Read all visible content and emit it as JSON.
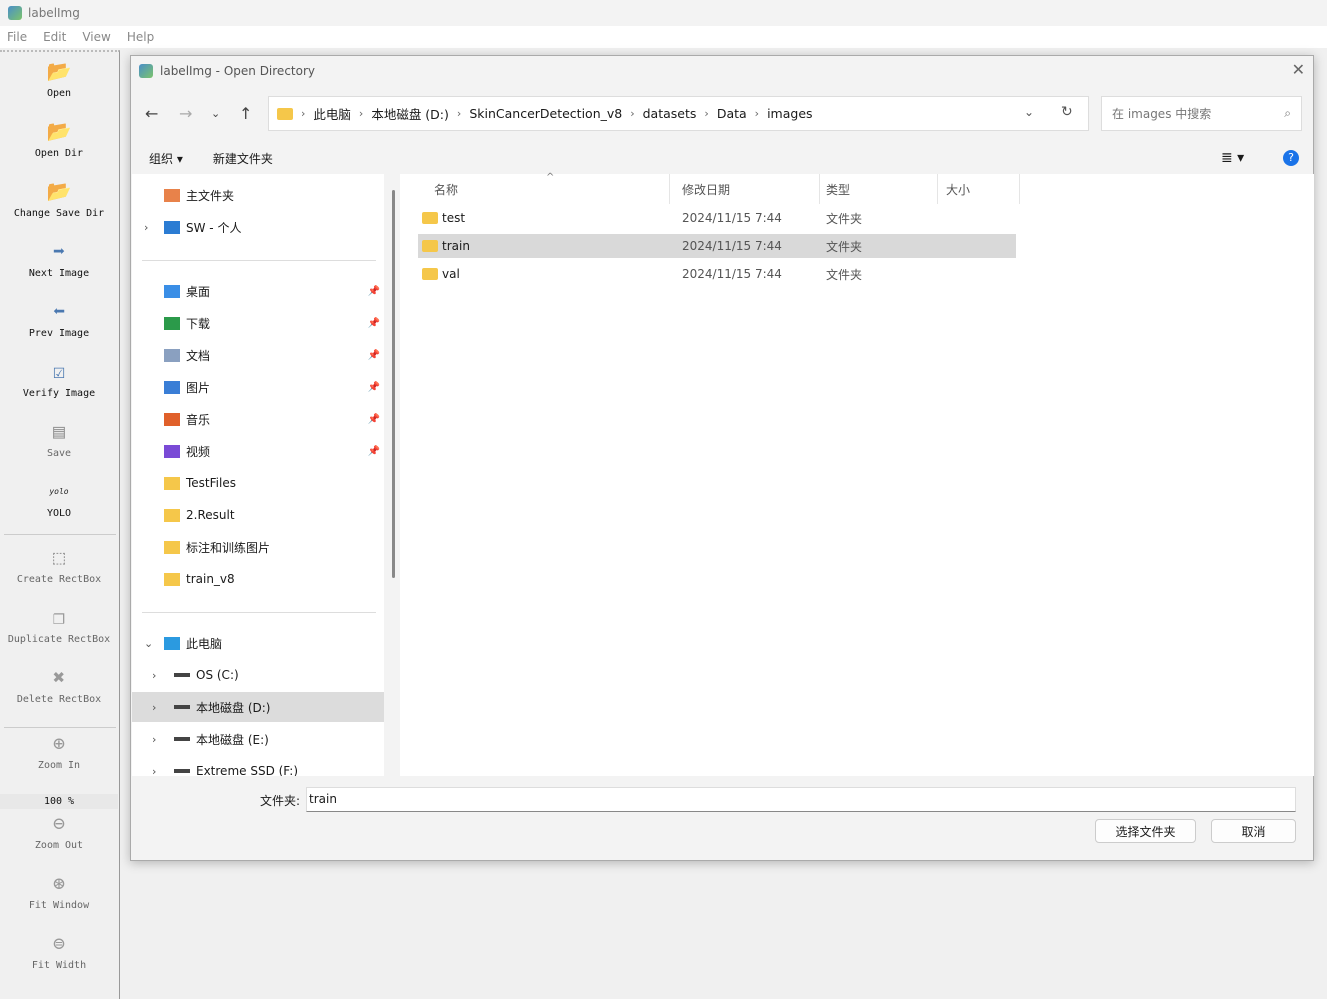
{
  "app": {
    "title": "labelImg",
    "menu": [
      "File",
      "Edit",
      "View",
      "Help"
    ]
  },
  "toolbar": [
    {
      "label": "Open",
      "icon": "folder-open-icon"
    },
    {
      "label": "Open Dir",
      "icon": "folder-open-icon"
    },
    {
      "label": "Change Save Dir",
      "icon": "folder-open-icon"
    },
    {
      "label": "Next Image",
      "icon": "arrow-right-icon"
    },
    {
      "label": "Prev Image",
      "icon": "arrow-left-icon"
    },
    {
      "label": "Verify Image",
      "icon": "checkbox-icon"
    },
    {
      "label": "Save",
      "icon": "save-icon"
    },
    {
      "label": "YOLO",
      "icon": "yolo-icon",
      "icon_text": "yolo"
    },
    {
      "label": "Create RectBox",
      "icon": "rect-create-icon"
    },
    {
      "label": "Duplicate RectBox",
      "icon": "duplicate-icon"
    },
    {
      "label": "Delete RectBox",
      "icon": "delete-icon"
    },
    {
      "label": "Zoom In",
      "icon": "zoom-in-icon"
    },
    {
      "label": "Zoom Out",
      "icon": "zoom-out-icon"
    },
    {
      "label": "Fit Window",
      "icon": "fit-window-icon"
    },
    {
      "label": "Fit Width",
      "icon": "fit-width-icon"
    }
  ],
  "zoom_level": "100 %",
  "dialog": {
    "title": "labelImg - Open Directory",
    "breadcrumb": [
      "此电脑",
      "本地磁盘 (D:)",
      "SkinCancerDetection_v8",
      "datasets",
      "Data",
      "images"
    ],
    "search_placeholder": "在 images 中搜索",
    "organize": "组织",
    "new_folder": "新建文件夹",
    "nav": {
      "top": [
        {
          "label": "主文件夹"
        },
        {
          "label": "SW - 个人"
        }
      ],
      "quick": [
        {
          "label": "桌面"
        },
        {
          "label": "下载"
        },
        {
          "label": "文档"
        },
        {
          "label": "图片"
        },
        {
          "label": "音乐"
        },
        {
          "label": "视频"
        },
        {
          "label": "TestFiles"
        },
        {
          "label": "2.Result"
        },
        {
          "label": "标注和训练图片"
        },
        {
          "label": "train_v8"
        }
      ],
      "pc": {
        "label": "此电脑",
        "drives": [
          {
            "label": "OS (C:)"
          },
          {
            "label": "本地磁盘 (D:)"
          },
          {
            "label": "本地磁盘 (E:)"
          },
          {
            "label": "Extreme SSD (F:)"
          }
        ]
      }
    },
    "columns": [
      "名称",
      "修改日期",
      "类型",
      "大小"
    ],
    "files": [
      {
        "name": "test",
        "date": "2024/11/15 7:44",
        "type": "文件夹"
      },
      {
        "name": "train",
        "date": "2024/11/15 7:44",
        "type": "文件夹"
      },
      {
        "name": "val",
        "date": "2024/11/15 7:44",
        "type": "文件夹"
      }
    ],
    "folder_label": "文件夹:",
    "folder_value": "train",
    "select_button": "选择文件夹",
    "cancel_button": "取消"
  }
}
